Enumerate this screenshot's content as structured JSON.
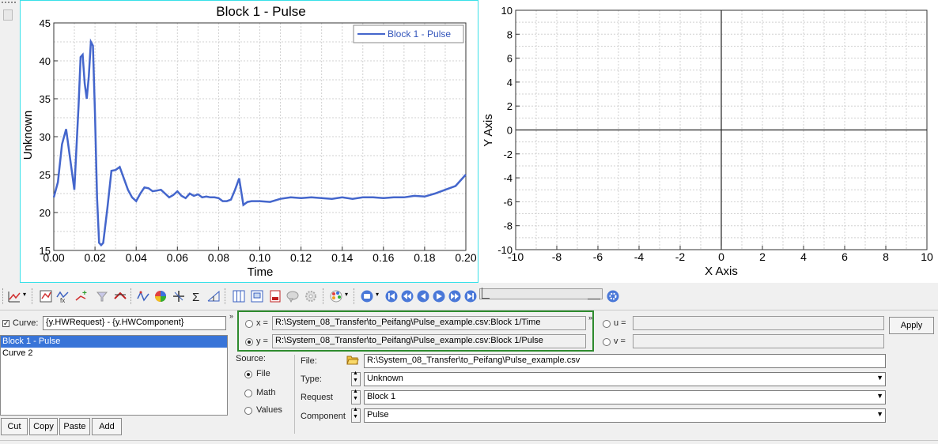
{
  "plot1": {
    "title": "Block 1 - Pulse",
    "legend_label": "Block 1 - Pulse",
    "xlabel": "Time",
    "ylabel": "Unknown",
    "line_color": "#4466cc"
  },
  "plot2": {
    "xlabel": "X Axis",
    "ylabel": "Y Axis"
  },
  "chart_data": [
    {
      "type": "line",
      "title": "Block 1 - Pulse",
      "xlabel": "Time",
      "ylabel": "Unknown",
      "xlim": [
        0.0,
        0.2
      ],
      "ylim": [
        15,
        45
      ],
      "x_ticks": [
        "0.00",
        "0.02",
        "0.04",
        "0.06",
        "0.08",
        "0.10",
        "0.12",
        "0.14",
        "0.16",
        "0.18",
        "0.20"
      ],
      "y_ticks": [
        "15",
        "20",
        "25",
        "30",
        "35",
        "40",
        "45"
      ],
      "grid": true,
      "legend": "top-right",
      "series": [
        {
          "name": "Block 1 - Pulse",
          "x": [
            0.0,
            0.002,
            0.004,
            0.006,
            0.008,
            0.01,
            0.012,
            0.013,
            0.014,
            0.015,
            0.016,
            0.017,
            0.018,
            0.019,
            0.02,
            0.021,
            0.022,
            0.023,
            0.024,
            0.026,
            0.028,
            0.03,
            0.032,
            0.034,
            0.036,
            0.038,
            0.04,
            0.042,
            0.044,
            0.046,
            0.048,
            0.05,
            0.052,
            0.054,
            0.056,
            0.058,
            0.06,
            0.062,
            0.064,
            0.066,
            0.068,
            0.07,
            0.072,
            0.074,
            0.076,
            0.078,
            0.08,
            0.082,
            0.084,
            0.086,
            0.088,
            0.09,
            0.092,
            0.094,
            0.096,
            0.1,
            0.105,
            0.11,
            0.115,
            0.12,
            0.125,
            0.13,
            0.135,
            0.14,
            0.145,
            0.15,
            0.155,
            0.16,
            0.165,
            0.17,
            0.175,
            0.18,
            0.185,
            0.19,
            0.195,
            0.2
          ],
          "y": [
            22.0,
            24.0,
            29.0,
            31.0,
            27.0,
            23.0,
            34.0,
            40.5,
            40.8,
            37.0,
            35.0,
            38.0,
            42.5,
            42.0,
            33.0,
            22.0,
            16.0,
            15.7,
            16.0,
            20.5,
            25.5,
            25.6,
            26.0,
            24.5,
            23.0,
            22.0,
            21.5,
            22.5,
            23.3,
            23.2,
            22.8,
            22.9,
            23.0,
            22.5,
            22.0,
            22.3,
            22.8,
            22.2,
            21.9,
            22.5,
            22.2,
            22.4,
            22.0,
            22.1,
            22.0,
            22.0,
            21.9,
            21.5,
            21.5,
            21.7,
            23.0,
            24.5,
            21.0,
            21.4,
            21.5,
            21.5,
            21.4,
            21.8,
            22.0,
            21.9,
            22.0,
            21.9,
            21.8,
            22.0,
            21.8,
            22.0,
            22.0,
            21.9,
            22.0,
            22.0,
            22.2,
            22.1,
            22.5,
            23.0,
            23.5,
            25.0
          ]
        }
      ]
    },
    {
      "type": "line",
      "title": "",
      "xlabel": "X Axis",
      "ylabel": "Y Axis",
      "xlim": [
        -10,
        10
      ],
      "ylim": [
        -10,
        10
      ],
      "x_ticks": [
        "-10",
        "-8",
        "-6",
        "-4",
        "-2",
        "0",
        "2",
        "4",
        "6",
        "8",
        "10"
      ],
      "y_ticks": [
        "-10",
        "-8",
        "-6",
        "-4",
        "-2",
        "0",
        "2",
        "4",
        "6",
        "8",
        "10"
      ],
      "grid": true,
      "series": []
    }
  ],
  "curve_panel": {
    "curve_label": "Curve:",
    "curve_value": "{y.HWRequest} - {y.HWComponent}",
    "curve_checked": true,
    "items": [
      "Block 1 - Pulse",
      "Curve 2"
    ],
    "selected_index": 0,
    "buttons": [
      "Cut",
      "Copy",
      "Paste",
      "Add"
    ]
  },
  "xy_panel": {
    "x_label": "x =",
    "x_value": "R:\\System_08_Transfer\\to_Peifang\\Pulse_example.csv:Block 1/Time",
    "y_label": "y =",
    "y_value": "R:\\System_08_Transfer\\to_Peifang\\Pulse_example.csv:Block 1/Pulse",
    "u_label": "u =",
    "v_label": "v =",
    "apply_label": "Apply",
    "highlight_color": "#2e8b2e"
  },
  "source_panel": {
    "source_label": "Source:",
    "options": [
      "File",
      "Math",
      "Values"
    ],
    "selected": "File"
  },
  "file_panel": {
    "file_label": "File:",
    "file_value": "R:\\System_08_Transfer\\to_Peifang\\Pulse_example.csv",
    "type_label": "Type:",
    "type_value": "Unknown",
    "request_label": "Request",
    "request_value": "Block 1",
    "component_label": "Component",
    "component_value": "Pulse"
  }
}
